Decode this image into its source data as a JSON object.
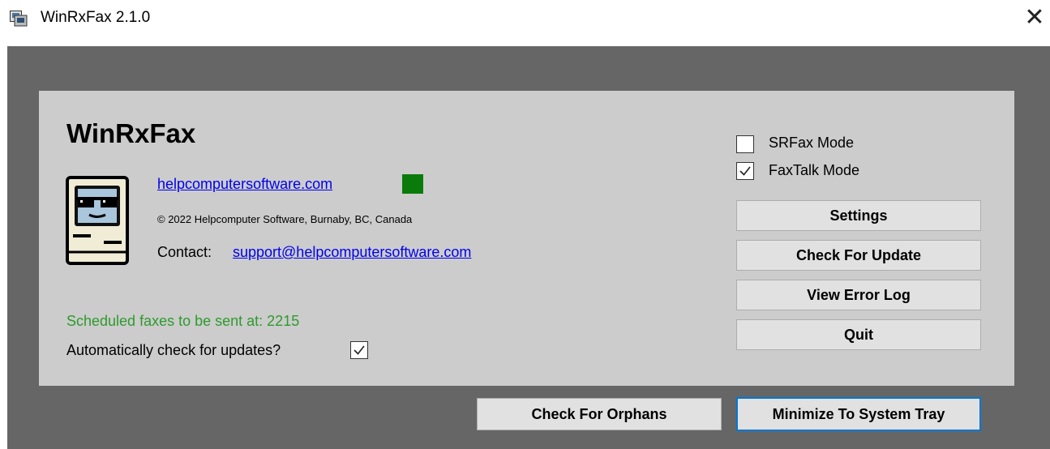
{
  "window": {
    "title": "WinRxFax 2.1.0",
    "close_glyph": "✕",
    "icon": "app-icon"
  },
  "main": {
    "app_name": "WinRxFax",
    "logo": "mac-computer-sunglasses-icon",
    "website_link": "helpcomputersoftware.com",
    "status_color": "#0a7a0a",
    "copyright": "© 2022 Helpcomputer Software, Burnaby, BC, Canada",
    "contact_label": "Contact:",
    "contact_email": "support@helpcomputersoftware.com",
    "scheduled_text": "Scheduled faxes to be sent at: 2215",
    "auto_update_label": "Automatically check for updates?",
    "auto_update_checked": true
  },
  "modes": {
    "srfax_label": "SRFax Mode",
    "srfax_checked": false,
    "faxtalk_label": "FaxTalk Mode",
    "faxtalk_checked": true
  },
  "buttons": {
    "settings": "Settings",
    "check_update": "Check For Update",
    "view_error_log": "View Error Log",
    "quit": "Quit",
    "check_orphans": "Check For Orphans",
    "minimize_tray": "Minimize To System Tray"
  },
  "colors": {
    "workspace": "#666666",
    "panel": "#cccccc",
    "scheduled_text": "#2e9a2e",
    "link": "#0000ee",
    "focus_border": "#0078d7"
  }
}
